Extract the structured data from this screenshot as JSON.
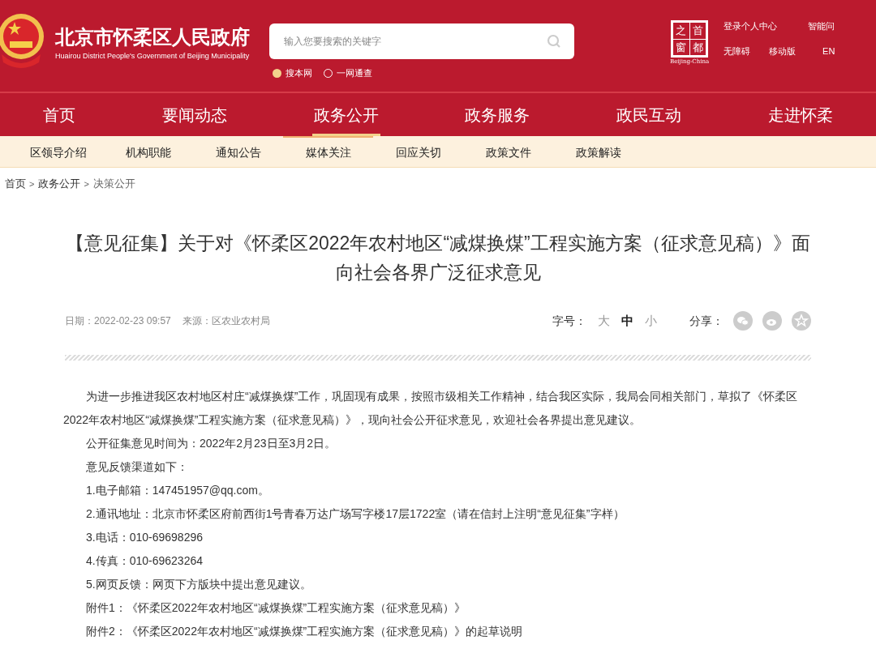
{
  "header": {
    "site_title": "北京市怀柔区人民政府",
    "site_subtitle": "Huairou District People's Government of Beijing Municipality",
    "search": {
      "placeholder": "输入您要搜索的关键字",
      "scopes": [
        {
          "label": "搜本网",
          "selected": true
        },
        {
          "label": "一网通查",
          "selected": false
        }
      ]
    },
    "partner_logo": {
      "chars": [
        "之",
        "首",
        "窗",
        "都"
      ],
      "caption": "Beijing-China"
    },
    "links_top": [
      "登录个人中心",
      "智能问"
    ],
    "links_bottom": [
      "无障碍",
      "移动版",
      "EN"
    ]
  },
  "main_nav": [
    {
      "label": "首页",
      "selected": false
    },
    {
      "label": "要闻动态",
      "selected": false
    },
    {
      "label": "政务公开",
      "selected": true
    },
    {
      "label": "政务服务",
      "selected": false
    },
    {
      "label": "政民互动",
      "selected": false
    },
    {
      "label": "走进怀柔",
      "selected": false
    }
  ],
  "sub_nav": [
    {
      "label": "区领导介绍",
      "selected": false
    },
    {
      "label": "机构职能",
      "selected": false
    },
    {
      "label": "通知公告",
      "selected": false
    },
    {
      "label": "媒体关注",
      "selected": true
    },
    {
      "label": "回应关切",
      "selected": false
    },
    {
      "label": "政策文件",
      "selected": false
    },
    {
      "label": "政策解读",
      "selected": false
    }
  ],
  "breadcrumb": [
    "首页",
    "政务公开",
    "决策公开"
  ],
  "breadcrumb_separator": ">",
  "article": {
    "title": "【意见征集】关于对《怀柔区2022年农村地区“减煤换煤”工程实施方案（征求意见稿）》面向社会各界广泛征求意见",
    "date": "日期：2022-02-23 09:57",
    "source": "来源：区农业农村局",
    "font_size_label": "字号：",
    "font_sizes": [
      {
        "label": "大",
        "selected": false
      },
      {
        "label": "中",
        "selected": true
      },
      {
        "label": "小",
        "selected": false
      }
    ],
    "share_label": "分享：",
    "paragraphs": [
      "为进一步推进我区农村地区村庄“减煤换煤”工作，巩固现有成果，按照市级相关工作精神，结合我区实际，我局会同相关部门，草拟了《怀柔区2022年农村地区“减煤换煤”工程实施方案（征求意见稿）》，现向社会公开征求意见，欢迎社会各界提出意见建议。",
      "公开征集意见时间为：2022年2月23日至3月2日。",
      "意见反馈渠道如下：",
      "1.电子邮箱：147451957@qq.com。",
      "2.通讯地址：北京市怀柔区府前西街1号青春万达广场写字楼17层1722室（请在信封上注明“意见征集”字样）",
      "3.电话：010-69698296",
      "4.传真：010-69623264",
      "5.网页反馈：网页下方版块中提出意见建议。",
      "附件1：《怀柔区2022年农村地区“减煤换煤”工程实施方案（征求意见稿）》",
      "附件2：《怀柔区2022年农村地区“减煤换煤”工程实施方案（征求意见稿）》的起草说明"
    ]
  }
}
